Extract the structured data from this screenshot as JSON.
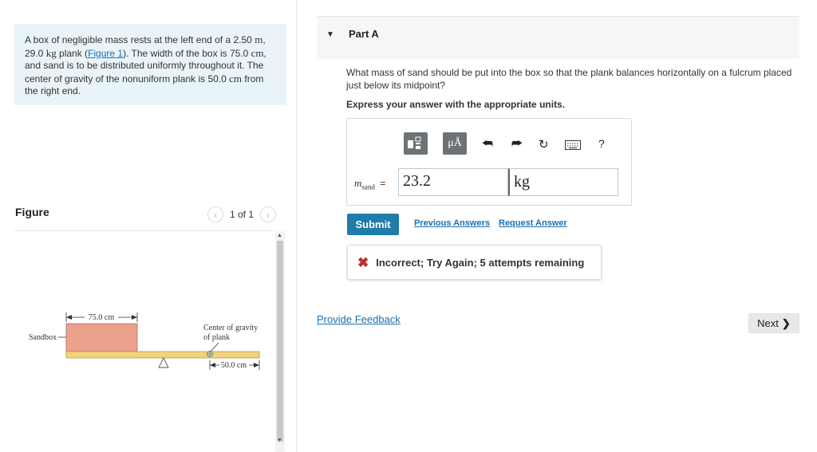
{
  "problem": {
    "t1": "A box of negligible mass rests at the left end of a 2.50 ",
    "u1": "m",
    "t2": ", 29.0 ",
    "u2": "kg",
    "t3": " plank (",
    "figlink": "Figure 1",
    "t4": "). The width of the box is 75.0 ",
    "u3": "cm",
    "t5": ", and sand is to be distributed uniformly throughout it. The center of gravity of the nonuniform plank is 50.0 ",
    "u4": "cm",
    "t6": " from the right end."
  },
  "figure": {
    "heading": "Figure",
    "pager": "1 of 1",
    "dim_box": "75.0 cm",
    "label_sandbox": "Sandbox",
    "label_cg1": "Center of gravity",
    "label_cg2": "of plank",
    "dim_cg": "50.0 cm"
  },
  "part": {
    "title": "Part A",
    "question": "What mass of sand should be put into the box so that the plank balances horizontally on a fulcrum placed just below its midpoint?",
    "instruction": "Express your answer with the appropriate units.",
    "toolbar": {
      "units_label": "μÅ",
      "help": "?"
    },
    "variable": "m",
    "variable_sub": "sand",
    "equals": "=",
    "value": "23.2",
    "unit": "kg",
    "submit": "Submit",
    "previous_answers": "Previous Answers",
    "request_answer": "Request Answer",
    "feedback": "Incorrect; Try Again; 5 attempts remaining"
  },
  "footer": {
    "provide_feedback": "Provide Feedback",
    "next": "Next"
  },
  "colors": {
    "accent": "#1f7cab",
    "sandbox": "#eba18b",
    "plank": "#f2d27a",
    "error": "#c52b2b",
    "problem_bg": "#e9f4f8"
  }
}
